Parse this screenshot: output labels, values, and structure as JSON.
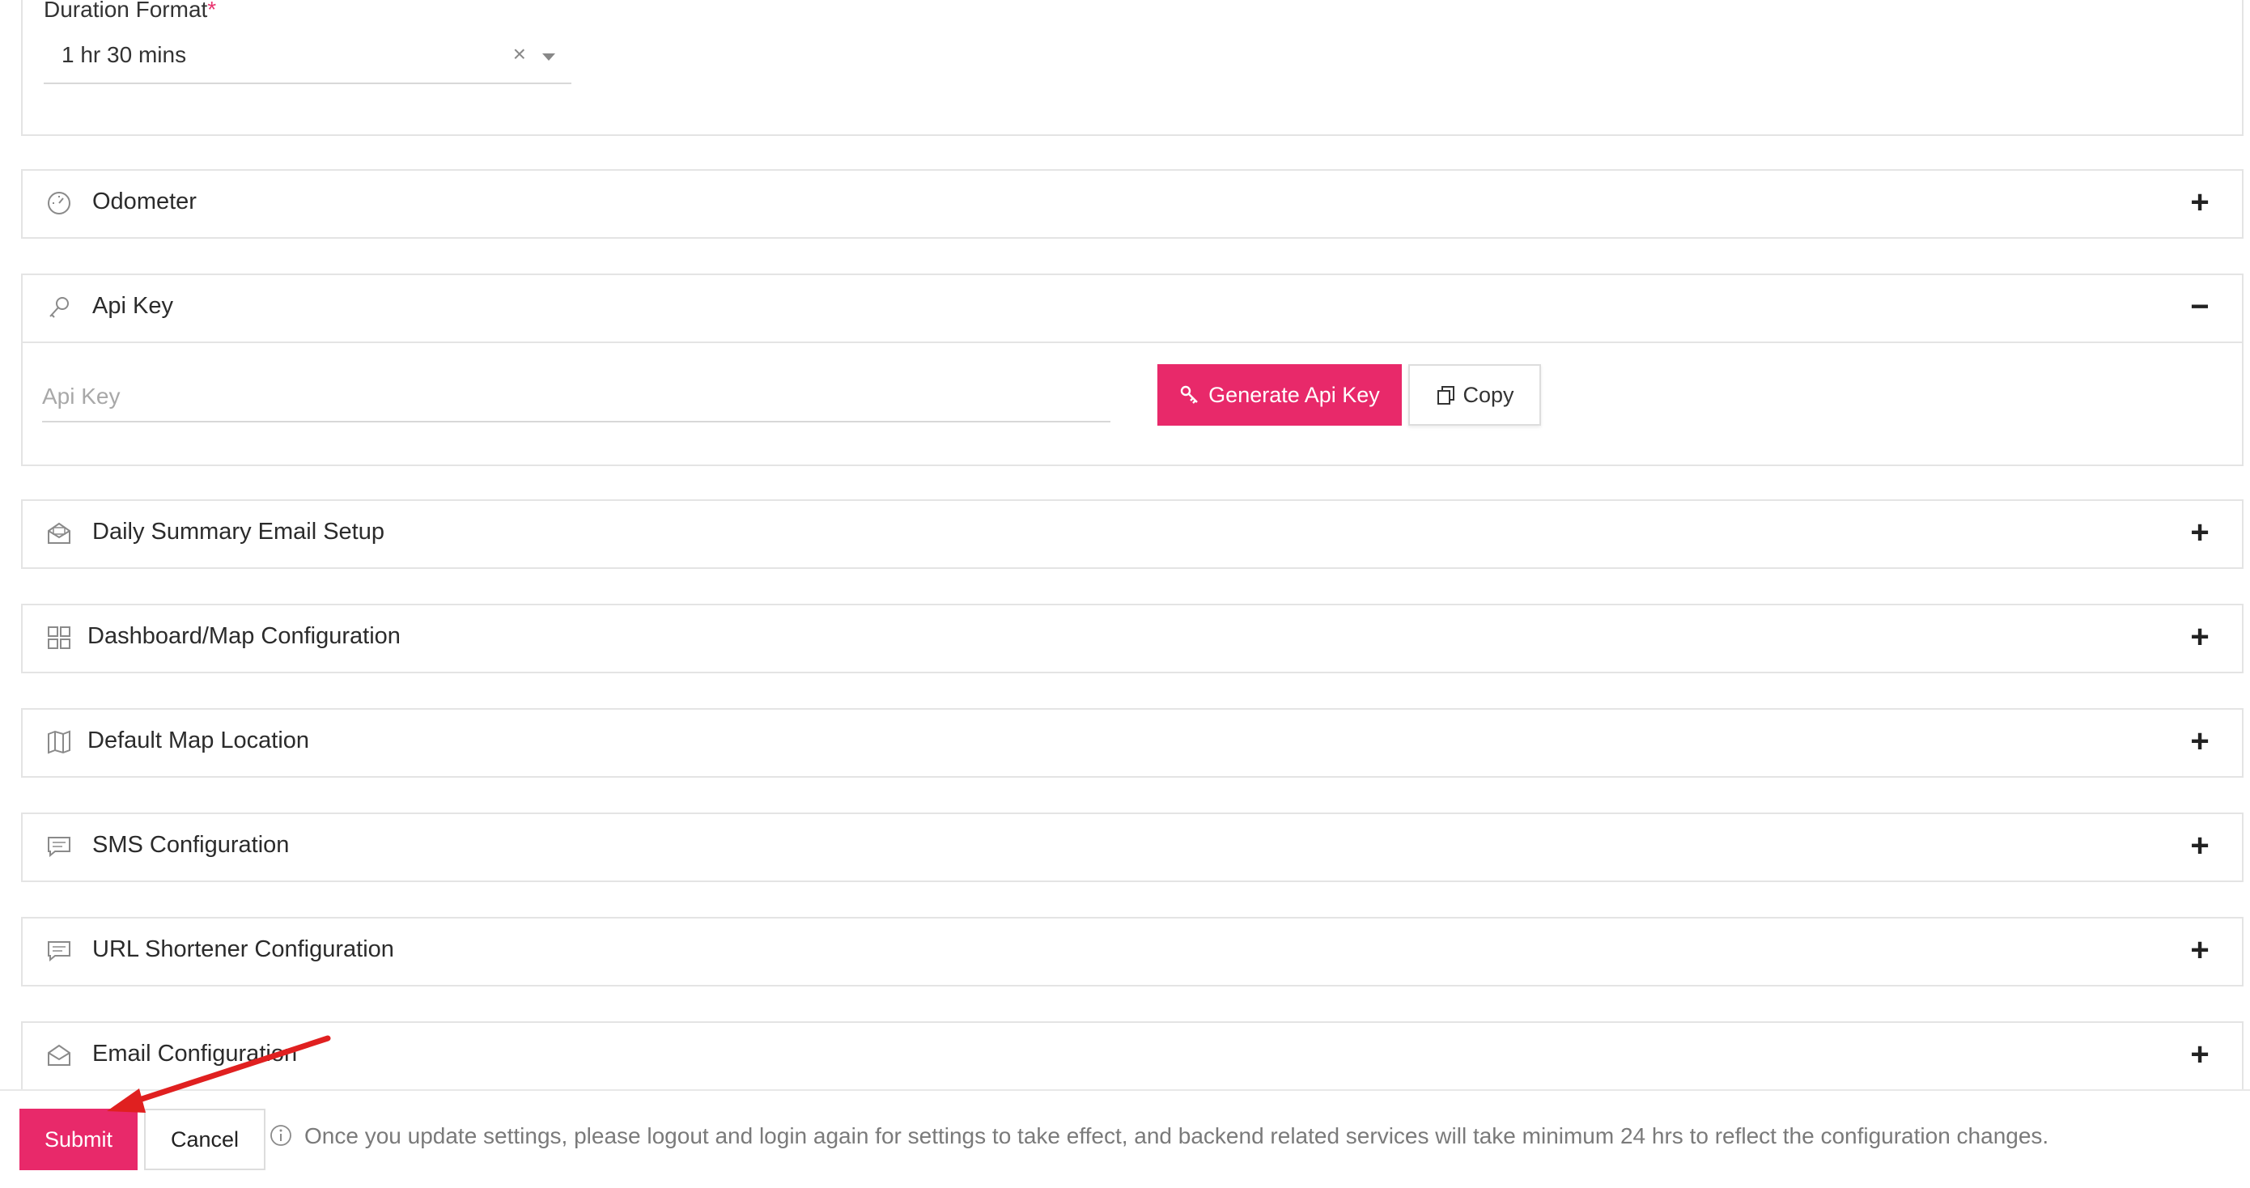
{
  "duration": {
    "label": "Duration Format",
    "required_mark": "*",
    "selected_value": "1 hr 30 mins",
    "clear_glyph": "×"
  },
  "panels": [
    {
      "title": "Odometer",
      "icon": "speedometer-icon",
      "toggle": "+"
    },
    {
      "title": "Api Key",
      "icon": "key-icon",
      "toggle": "−"
    },
    {
      "title": "Daily Summary Email Setup",
      "icon": "envelope-open-icon",
      "toggle": "+"
    },
    {
      "title": "Dashboard/Map Configuration",
      "icon": "grid-icon",
      "toggle": "+"
    },
    {
      "title": "Default Map Location",
      "icon": "map-icon",
      "toggle": "+"
    },
    {
      "title": "SMS Configuration",
      "icon": "message-icon",
      "toggle": "+"
    },
    {
      "title": "URL Shortener Configuration",
      "icon": "message-icon",
      "toggle": "+"
    },
    {
      "title": "Email Configuration",
      "icon": "envelope-open-icon",
      "toggle": "+"
    }
  ],
  "api_key": {
    "placeholder": "Api Key",
    "generate_label": "Generate Api Key",
    "copy_label": "Copy"
  },
  "footer": {
    "submit_label": "Submit",
    "cancel_label": "Cancel",
    "info_text": "Once you update settings, please logout and login again for settings to take effect, and backend related services will take minimum 24 hrs to reflect the configuration changes."
  },
  "colors": {
    "accent": "#e8296a",
    "annotation_arrow": "#e02020"
  }
}
